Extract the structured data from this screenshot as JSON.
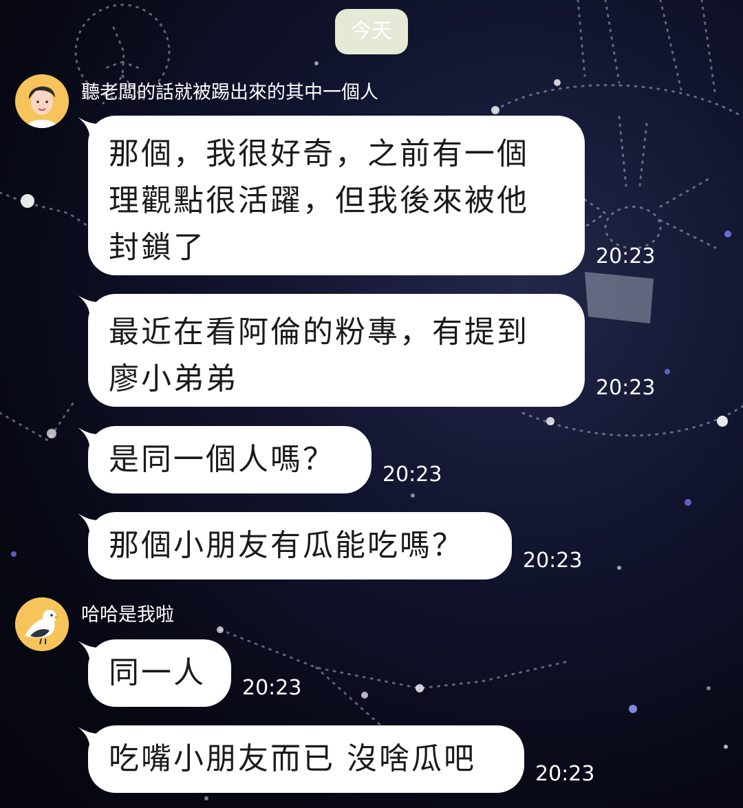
{
  "chat": {
    "date_label": "今天",
    "senders": [
      {
        "name": "聽老闆的話就被踢出來的其中一個人",
        "avatar": "man-avatar-icon"
      },
      {
        "name": "哈哈是我啦",
        "avatar": "bird-avatar-icon"
      }
    ],
    "messages": [
      {
        "lines": [
          "那個，我很好奇，之前有一個",
          "理觀點很活躍，但我後來被他",
          "封鎖了"
        ],
        "time": "20:23"
      },
      {
        "lines": [
          "最近在看阿倫的粉專，有提到",
          "廖小弟弟"
        ],
        "time": "20:23"
      },
      {
        "text": "是同一個人嗎？",
        "time": "20:23"
      },
      {
        "text": "那個小朋友有瓜能吃嗎？",
        "time": "20:23"
      },
      {
        "text": "同一人",
        "time": "20:23"
      },
      {
        "text": "吃嘴小朋友而已 沒啥瓜吧",
        "time": "20:23"
      }
    ]
  },
  "theme": {
    "bubble_color": "#ffffff",
    "date_pill_color": "#e4ead6",
    "avatar_color": "#f7c35b",
    "background": "starry-constellation-night-sky"
  }
}
